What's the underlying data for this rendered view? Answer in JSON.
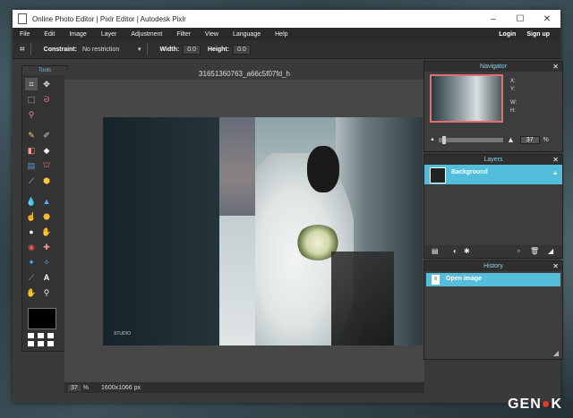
{
  "window": {
    "title": "Online Photo Editor | Pixlr Editor | Autodesk Pixlr",
    "controls": {
      "minimize": "–",
      "maximize": "☐",
      "close": "✕"
    }
  },
  "menubar": {
    "items": [
      "File",
      "Edit",
      "Image",
      "Layer",
      "Adjustment",
      "Filter",
      "View",
      "Language",
      "Help"
    ],
    "login": "Login",
    "signup": "Sign up"
  },
  "options": {
    "constraint_label": "Constraint:",
    "constraint_value": "No restriction",
    "width_label": "Width:",
    "width_value": "0.0",
    "height_label": "Height:",
    "height_value": "0.0"
  },
  "tools": {
    "header": "Tools"
  },
  "canvas": {
    "title": "31651360763_a66c5f07fd_h",
    "watermark": "STUDIO",
    "zoom": "37",
    "zoom_unit": "%",
    "dimensions": "1600x1066 px"
  },
  "navigator": {
    "header": "Navigator",
    "x_label": "X:",
    "y_label": "Y:",
    "w_label": "W:",
    "h_label": "H:",
    "zoom": "37",
    "zoom_unit": "%"
  },
  "layers": {
    "header": "Layers",
    "items": [
      {
        "name": "Background",
        "locked": true
      }
    ]
  },
  "history": {
    "header": "History",
    "items": [
      {
        "name": "Open image"
      }
    ]
  },
  "watermark_brand": {
    "pre": "GEN",
    "post": "K"
  },
  "colors": {
    "accent": "#53bedc",
    "nav_frame": "#e07070",
    "brand_red": "#e23a2a"
  }
}
